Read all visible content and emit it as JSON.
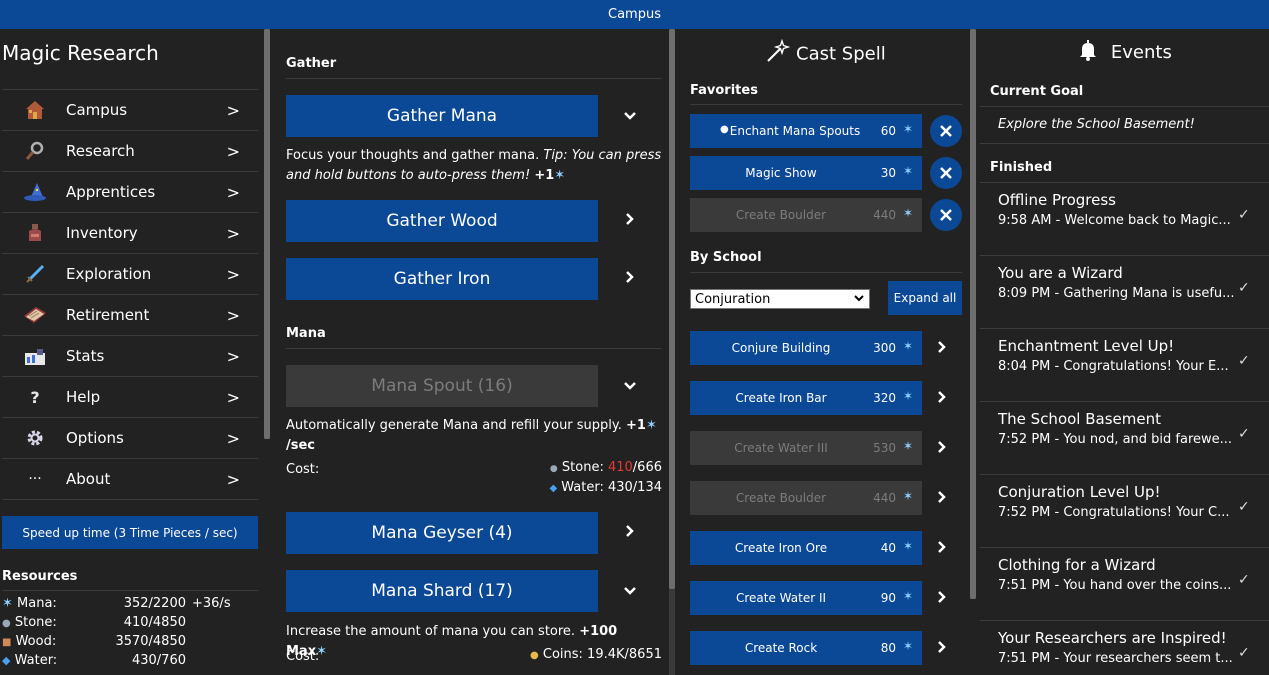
{
  "topbar": {
    "title": "Campus"
  },
  "sidebar": {
    "app_title": "Magic Research",
    "items": [
      {
        "label": "Campus",
        "icon": "house-icon"
      },
      {
        "label": "Research",
        "icon": "magnifier-icon"
      },
      {
        "label": "Apprentices",
        "icon": "wizard-hat-icon"
      },
      {
        "label": "Inventory",
        "icon": "potion-icon"
      },
      {
        "label": "Exploration",
        "icon": "sword-icon"
      },
      {
        "label": "Retirement",
        "icon": "book-icon"
      },
      {
        "label": "Stats",
        "icon": "chart-icon"
      },
      {
        "label": "Help",
        "icon": "question-icon"
      },
      {
        "label": "Options",
        "icon": "gear-icon"
      },
      {
        "label": "About",
        "icon": "ellipsis-icon"
      }
    ],
    "chevron": ">",
    "speed_button": "Speed up time (3 Time Pieces / sec)",
    "resources_title": "Resources",
    "resources": [
      {
        "label": "Mana:",
        "value": "352/2200",
        "rate": "+36/s"
      },
      {
        "label": "Stone:",
        "value": "410/4850",
        "rate": ""
      },
      {
        "label": "Wood:",
        "value": "3570/4850",
        "rate": ""
      },
      {
        "label": "Water:",
        "value": "430/760",
        "rate": ""
      }
    ]
  },
  "actions": {
    "gather_title": "Gather",
    "gather_mana": "Gather Mana",
    "gather_mana_desc": "Focus your thoughts and gather mana.",
    "gather_mana_tip": "Tip: You can press and hold buttons to auto-press them!",
    "gather_mana_gain": "+1",
    "gather_wood": "Gather Wood",
    "gather_iron": "Gather Iron",
    "mana_title": "Mana",
    "mana_spout": "Mana Spout (16)",
    "mana_spout_desc": "Automatically generate Mana and refill your supply.",
    "mana_spout_gain": "+1",
    "mana_spout_unit": "/sec",
    "cost_label": "Cost:",
    "spout_cost_stone_label": "Stone:",
    "spout_cost_stone_have": "410",
    "spout_cost_stone_need": "/666",
    "spout_cost_water": "Water: 430/134",
    "mana_geyser": "Mana Geyser (4)",
    "mana_shard": "Mana Shard (17)",
    "mana_shard_desc": "Increase the amount of mana you can store.",
    "mana_shard_gain": "+100 Max",
    "shard_cost_coins": "Coins: 19.4K/8651"
  },
  "spells": {
    "title": "Cast Spell",
    "favorites_title": "Favorites",
    "favorites": [
      {
        "name": "Enchant Mana Spouts",
        "cost": "60",
        "active": true,
        "enabled": true
      },
      {
        "name": "Magic Show",
        "cost": "30",
        "active": false,
        "enabled": true
      },
      {
        "name": "Create Boulder",
        "cost": "440",
        "active": false,
        "enabled": false
      }
    ],
    "by_school_title": "By School",
    "school_selected": "Conjuration",
    "expand_all": "Expand all",
    "school_spells": [
      {
        "name": "Conjure Building",
        "cost": "300",
        "enabled": true
      },
      {
        "name": "Create Iron Bar",
        "cost": "320",
        "enabled": true
      },
      {
        "name": "Create Water III",
        "cost": "530",
        "enabled": false
      },
      {
        "name": "Create Boulder",
        "cost": "440",
        "enabled": false
      },
      {
        "name": "Create Iron Ore",
        "cost": "40",
        "enabled": true
      },
      {
        "name": "Create Water II",
        "cost": "90",
        "enabled": true
      },
      {
        "name": "Create Rock",
        "cost": "80",
        "enabled": true
      }
    ]
  },
  "events": {
    "title": "Events",
    "current_goal_title": "Current Goal",
    "current_goal": "Explore the School Basement!",
    "finished_title": "Finished",
    "finished": [
      {
        "title": "Offline Progress",
        "subtitle": "9:58 AM - Welcome back to Magic..."
      },
      {
        "title": "You are a Wizard",
        "subtitle": "8:09 PM - Gathering Mana is usefu..."
      },
      {
        "title": "Enchantment Level Up!",
        "subtitle": "8:04 PM - Congratulations! Your E..."
      },
      {
        "title": "The School Basement",
        "subtitle": "7:52 PM - You nod, and bid farewe..."
      },
      {
        "title": "Conjuration Level Up!",
        "subtitle": "7:52 PM - Congratulations! Your C..."
      },
      {
        "title": "Clothing for a Wizard",
        "subtitle": "7:51 PM - You hand over the coins..."
      },
      {
        "title": "Your Researchers are Inspired!",
        "subtitle": "7:51 PM - Your researchers seem t..."
      }
    ]
  },
  "colors": {
    "accent": "#0b4896",
    "background": "#222222",
    "disabled": "#3a3a3a",
    "warning": "#e53935",
    "mana": "#8fd0ff"
  }
}
